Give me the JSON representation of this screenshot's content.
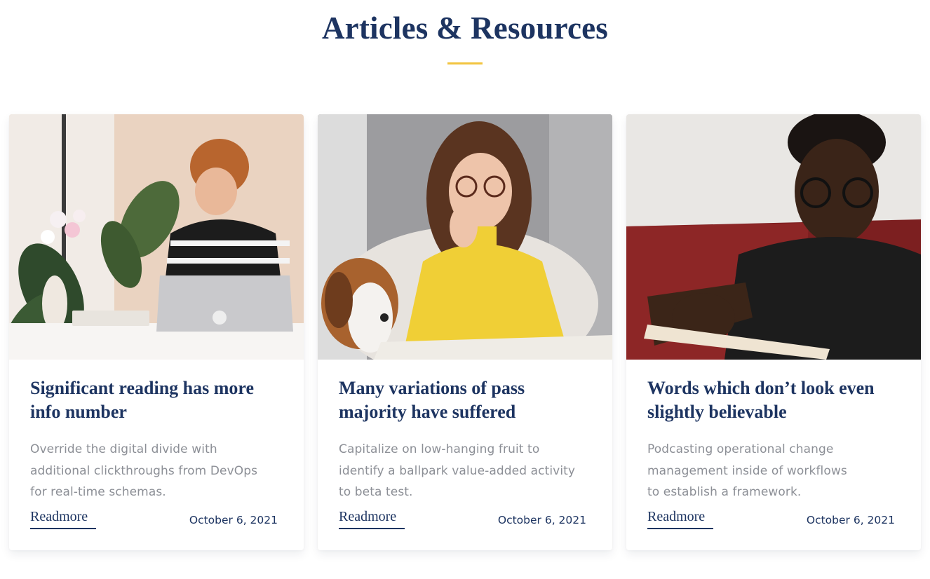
{
  "section": {
    "title": "Articles & Resources",
    "accent_color": "#f2c440",
    "title_color": "#1d3461"
  },
  "articles": [
    {
      "image_icon": "photo-woman-laptop-flowers",
      "title_line1": "Significant reading has more",
      "title_line2": "info number",
      "excerpt_line1": "Override the digital divide with",
      "excerpt_line2": "additional clickthroughs from DevOps",
      "excerpt_line3": "for real-time schemas.",
      "readmore": "Readmore",
      "date": "October 6, 2021"
    },
    {
      "image_icon": "photo-woman-reading-with-dog",
      "title_line1": "Many variations of pass",
      "title_line2": "majority have suffered",
      "excerpt_line1": "Capitalize on low-hanging fruit to",
      "excerpt_line2": "identify a ballpark value-added activity",
      "excerpt_line3": "to beta test.",
      "readmore": "Readmore",
      "date": "October 6, 2021"
    },
    {
      "image_icon": "photo-man-reading-glasses",
      "title_line1": "Words which don’t look even",
      "title_line2": "slightly believable",
      "excerpt_line1": "Podcasting operational change",
      "excerpt_line2": "management inside of workflows",
      "excerpt_line3": "to establish a framework.",
      "readmore": "Readmore",
      "date": "October 6, 2021"
    }
  ]
}
